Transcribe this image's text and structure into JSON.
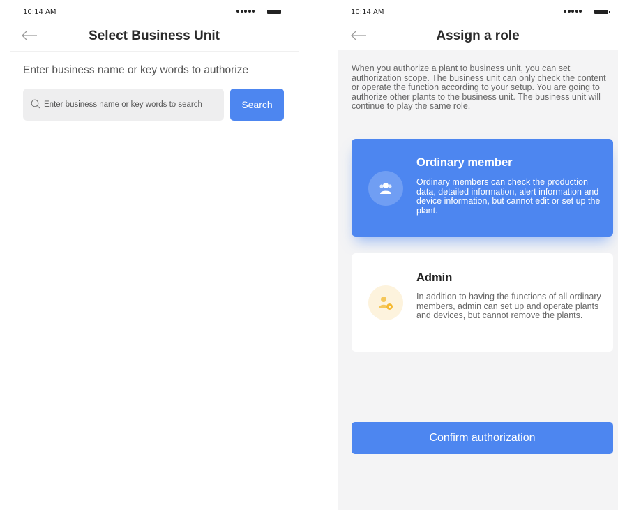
{
  "left_screen": {
    "status_bar": {
      "time": "10:14 AM"
    },
    "nav": {
      "title": "Select Business Unit"
    },
    "prompt": "Enter business name or key words to authorize",
    "search": {
      "placeholder": "Enter business name or key words to search",
      "button_label": "Search"
    }
  },
  "right_screen": {
    "status_bar": {
      "time": "10:14 AM"
    },
    "nav": {
      "title": "Assign a role"
    },
    "description": "When you authorize a plant to business unit, you can set authorization scope. The business unit can only check the content or operate the function according to your setup. You are going to authorize other plants to the business unit. The business unit will continue to play the same role.",
    "roles": [
      {
        "title": "Ordinary member",
        "text": "Ordinary members can check the production data, detailed information, alert information and device information, but cannot edit or set up the plant.",
        "icon": "group-icon",
        "selected": true
      },
      {
        "title": "Admin",
        "text": "In addition to having the functions of all ordinary members, admin can set up and operate plants and devices, but cannot remove the plants.",
        "icon": "admin-gear-icon",
        "selected": false
      }
    ],
    "confirm_label": "Confirm authorization"
  },
  "colors": {
    "accent": "#4d86f0",
    "admin_icon_bg": "#fdf3dd",
    "admin_icon": "#f5b931"
  }
}
